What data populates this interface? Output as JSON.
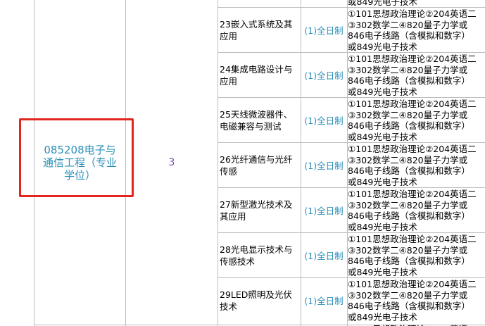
{
  "major": {
    "name": "085208电子与通信工程（专业学位）",
    "count": "3"
  },
  "study_mode": "(1)全日制",
  "exam_lines": [
    "①101思想政治理论②204英语二",
    "③302数学二④820量子力学或",
    "846电子线路（含模拟和数字）",
    "或849光电子技术"
  ],
  "partial_top_line": "或849光电子技术",
  "partial_bottom_line": "①101思想政治理论②204英语二",
  "directions": [
    "23嵌入式系统及其应用",
    "24集成电路设计与应用",
    "25天线微波器件、电磁兼容与测试",
    "26光纤通信与光纤传感",
    "27新型激光技术及其应用",
    "28光电显示技术与传感技术",
    "29LED照明及光伏技术"
  ],
  "colors": {
    "link_blue": "#2a8fb8",
    "count_purple": "#7a4bb8",
    "highlight_red": "#e2261f",
    "grid": "#bdbdbd"
  }
}
